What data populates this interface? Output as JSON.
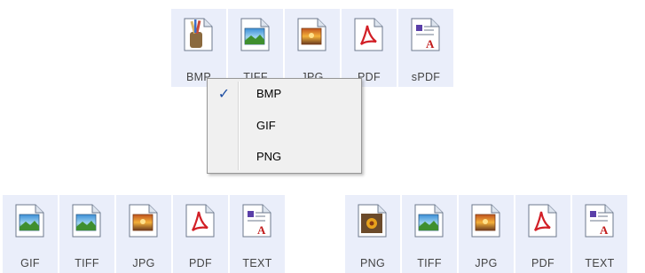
{
  "top_bar": {
    "items": [
      {
        "label": "BMP",
        "icon": "bitmap-paint-icon"
      },
      {
        "label": "TIFF",
        "icon": "tiff-image-icon"
      },
      {
        "label": "JPG",
        "icon": "jpg-image-icon"
      },
      {
        "label": "PDF",
        "icon": "pdf-icon"
      },
      {
        "label": "sPDF",
        "icon": "searchable-pdf-icon"
      }
    ]
  },
  "format_menu": {
    "items": [
      {
        "label": "BMP",
        "checked": true
      },
      {
        "label": "GIF",
        "checked": false
      },
      {
        "label": "PNG",
        "checked": false
      }
    ],
    "check_glyph": "✓"
  },
  "left_bar": {
    "items": [
      {
        "label": "GIF",
        "icon": "gif-image-icon"
      },
      {
        "label": "TIFF",
        "icon": "tiff-image-icon"
      },
      {
        "label": "JPG",
        "icon": "jpg-image-icon"
      },
      {
        "label": "PDF",
        "icon": "pdf-icon"
      },
      {
        "label": "TEXT",
        "icon": "text-document-icon"
      }
    ]
  },
  "right_bar": {
    "items": [
      {
        "label": "PNG",
        "icon": "png-image-icon"
      },
      {
        "label": "TIFF",
        "icon": "tiff-image-icon"
      },
      {
        "label": "JPG",
        "icon": "jpg-image-icon"
      },
      {
        "label": "PDF",
        "icon": "pdf-icon"
      },
      {
        "label": "TEXT",
        "icon": "text-document-icon"
      }
    ]
  }
}
